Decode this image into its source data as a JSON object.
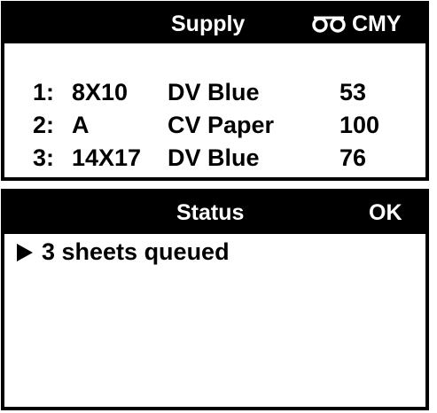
{
  "supply": {
    "title": "Supply",
    "ribbon_icon": "ribbon-cassette-icon",
    "ribbon_type": "CMY",
    "rows": [
      {
        "index": "1:",
        "size": "8X10",
        "media": "DV Blue",
        "count": "53"
      },
      {
        "index": "2:",
        "size": "A",
        "media": "CV Paper",
        "count": "100"
      },
      {
        "index": "3:",
        "size": "14X17",
        "media": "DV Blue",
        "count": "76"
      }
    ]
  },
  "status": {
    "title": "Status",
    "state": "OK",
    "arrow_icon": "play-arrow-icon",
    "message": "3 sheets queued"
  },
  "colors": {
    "header_bg": "#000000",
    "header_text": "#ffffff",
    "body_bg": "#ffffff",
    "body_text": "#000000"
  }
}
